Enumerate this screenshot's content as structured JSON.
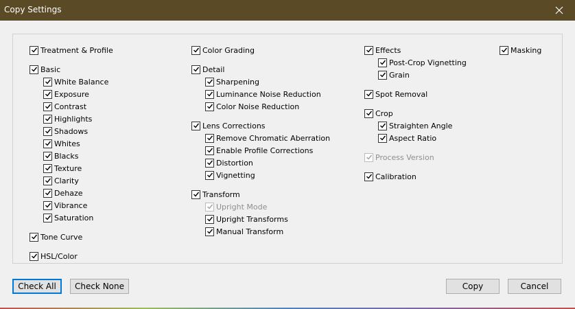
{
  "window": {
    "title": "Copy Settings"
  },
  "checkboxes": {
    "treatment_profile": "Treatment & Profile",
    "basic": "Basic",
    "white_balance": "White Balance",
    "exposure": "Exposure",
    "contrast": "Contrast",
    "highlights": "Highlights",
    "shadows": "Shadows",
    "whites": "Whites",
    "blacks": "Blacks",
    "texture": "Texture",
    "clarity": "Clarity",
    "dehaze": "Dehaze",
    "vibrance": "Vibrance",
    "saturation": "Saturation",
    "tone_curve": "Tone Curve",
    "hsl_color": "HSL/Color",
    "color_grading": "Color Grading",
    "detail": "Detail",
    "sharpening": "Sharpening",
    "luminance_noise": "Luminance Noise Reduction",
    "color_noise": "Color Noise Reduction",
    "lens_corrections": "Lens Corrections",
    "remove_ca": "Remove Chromatic Aberration",
    "profile_corrections": "Enable Profile Corrections",
    "distortion": "Distortion",
    "vignetting": "Vignetting",
    "transform": "Transform",
    "upright_mode": "Upright Mode",
    "upright_transforms": "Upright Transforms",
    "manual_transform": "Manual Transform",
    "effects": "Effects",
    "post_crop_vignetting": "Post-Crop Vignetting",
    "grain": "Grain",
    "spot_removal": "Spot Removal",
    "crop": "Crop",
    "straighten_angle": "Straighten Angle",
    "aspect_ratio": "Aspect Ratio",
    "process_version": "Process Version",
    "calibration": "Calibration",
    "masking": "Masking"
  },
  "buttons": {
    "check_all": "Check All",
    "check_none": "Check None",
    "copy": "Copy",
    "cancel": "Cancel"
  }
}
